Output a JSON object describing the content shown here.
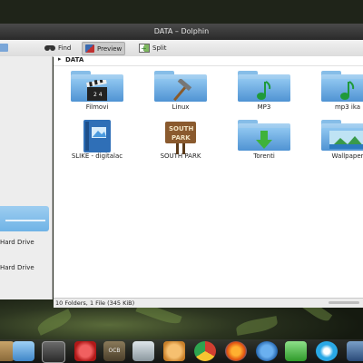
{
  "window": {
    "title": "DATA – Dolphin"
  },
  "toolbar": {
    "buttons": [
      {
        "label": "Find",
        "icon": "binoculars-icon"
      },
      {
        "label": "Preview",
        "icon": "preview-icon"
      },
      {
        "label": "Split",
        "icon": "split-icon"
      }
    ]
  },
  "breadcrumb": {
    "current": "DATA"
  },
  "sidebar": {
    "items": [
      {
        "label": "Hard Drive"
      },
      {
        "label": "Hard Drive"
      }
    ]
  },
  "files": [
    {
      "name": "Filmovi",
      "type": "folder",
      "emblem": "clapperboard-icon"
    },
    {
      "name": "Linux",
      "type": "folder",
      "emblem": "hammer-icon"
    },
    {
      "name": "MP3",
      "type": "folder",
      "emblem": "music-note-icon"
    },
    {
      "name": "mp3 ika",
      "type": "folder",
      "emblem": "music-note-icon"
    },
    {
      "name": "SLIKE - digitalac",
      "type": "folder",
      "emblem": "image-book-icon"
    },
    {
      "name": "SOUTH PARK",
      "type": "folder",
      "emblem": "south-park-sign-icon",
      "sign_text_1": "SOUTH",
      "sign_text_2": "PARK"
    },
    {
      "name": "Torenti",
      "type": "folder",
      "emblem": "download-arrow-icon"
    },
    {
      "name": "Wallpaper",
      "type": "folder",
      "emblem": "landscape-icon"
    }
  ],
  "status": {
    "text": "10 Folders, 1 File (345 KiB)"
  },
  "colors": {
    "folder": "#6aaee6",
    "selection": "#8cc4ee",
    "titlebar": "#3a3a3a"
  },
  "dock": {
    "icons": [
      "pidgin-icon",
      "dolphin-icon",
      "monitor-icon",
      "power-icon",
      "ocb-icon",
      "gem-icon",
      "pacman-icon",
      "chrome-icon",
      "firefox-icon",
      "bird-icon",
      "crossover-icon",
      "skype-icon",
      "network-icon"
    ],
    "ocb_label": "OCB"
  }
}
